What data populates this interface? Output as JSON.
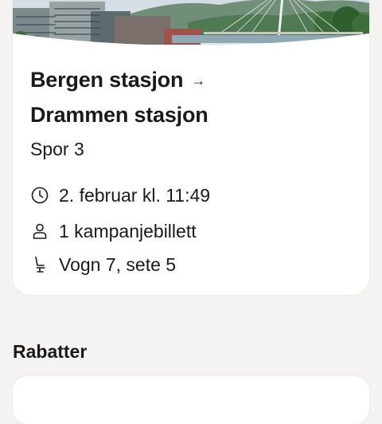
{
  "ticket": {
    "from": "Bergen stasjon",
    "arrow": "→",
    "to": "Drammen stasjon",
    "track": "Spor 3",
    "departure": "2. februar kl. 11:49",
    "ticket_type": "1 kampanjebillett",
    "seat": "Vogn 7, sete 5"
  },
  "discounts": {
    "title": "Rabatter"
  },
  "icons": {
    "time": "clock-icon",
    "passenger": "person-icon",
    "seat": "seat-icon"
  },
  "colors": {
    "background": "#f4f3f1",
    "card": "#ffffff",
    "text": "#1a1a1a"
  }
}
